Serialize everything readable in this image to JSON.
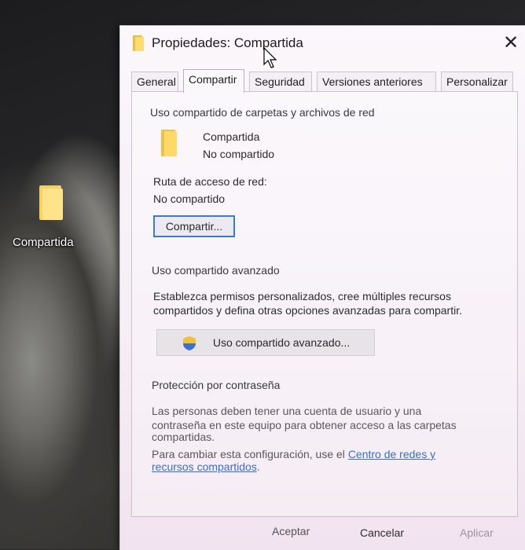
{
  "desktop": {
    "icon_label": "Compartida"
  },
  "dialog": {
    "title": "Propiedades: Compartida",
    "close": "✕",
    "tabs": [
      {
        "label": "General"
      },
      {
        "label": "Compartir"
      },
      {
        "label": "Seguridad"
      },
      {
        "label": "Versiones anteriores"
      },
      {
        "label": "Personalizar"
      }
    ],
    "active_tab": "Compartir",
    "network_sharing": {
      "heading": "Uso compartido de carpetas y archivos de red",
      "folder_name": "Compartida",
      "folder_status": "No compartido",
      "path_label": "Ruta de acceso de red:",
      "path_value": "No compartido",
      "share_button": "Compartir..."
    },
    "advanced_sharing": {
      "heading": "Uso compartido avanzado",
      "description_line1": "Establezca permisos personalizados, cree múltiples recursos",
      "description_line2": "compartidos y defina otras opciones avanzadas para compartir.",
      "button": "Uso compartido avanzado..."
    },
    "password_protection": {
      "heading": "Protección por contraseña",
      "line1": "Las personas deben tener una cuenta de usuario y una",
      "line2": "contraseña en este equipo para obtener acceso a las carpetas",
      "line3": "compartidas.",
      "line4_prefix": "Para cambiar esta configuración, use el ",
      "link_part1": "Centro de redes y",
      "link_part2": "recursos compartidos",
      "line4_suffix": "."
    },
    "footer": {
      "ok": "Aceptar",
      "cancel": "Cancelar",
      "apply": "Aplicar"
    }
  },
  "colors": {
    "folder": "#ffd968",
    "link": "#3a6fc4",
    "focus_border": "#3b7bd4"
  }
}
